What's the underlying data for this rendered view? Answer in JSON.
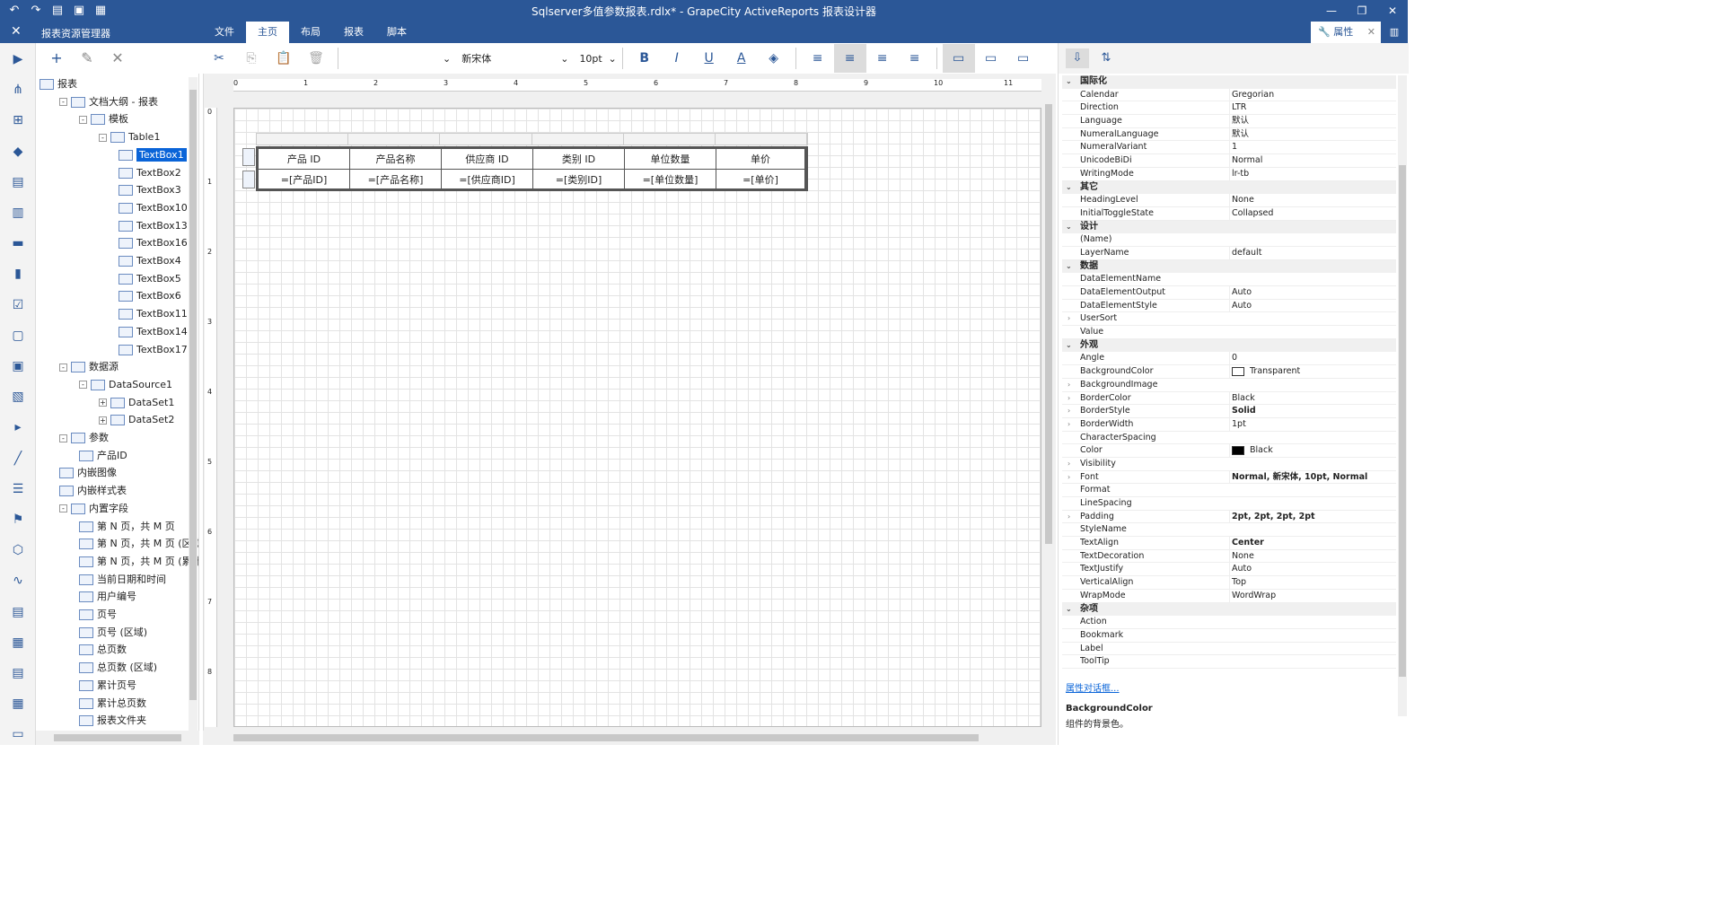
{
  "title": "Sqlserver多值参数报表.rdlx* - GrapeCity ActiveReports 报表设计器",
  "explorer_title": "报表资源管理器",
  "tabs": [
    "文件",
    "主页",
    "布局",
    "报表",
    "脚本"
  ],
  "properties_tab": "属性",
  "font": {
    "name": "新宋体",
    "size": "10pt"
  },
  "ruler": {
    "h": [
      "0",
      "1",
      "2",
      "3",
      "4",
      "5",
      "6",
      "7",
      "8",
      "9",
      "10",
      "11"
    ],
    "v": [
      "0",
      "1",
      "2",
      "3",
      "4",
      "5",
      "6",
      "7",
      "8"
    ]
  },
  "tree": [
    {
      "label": "报表",
      "level": 0,
      "tog": ""
    },
    {
      "label": "文档大纲 - 报表",
      "level": 1,
      "tog": "-"
    },
    {
      "label": "模板",
      "level": 2,
      "tog": "-"
    },
    {
      "label": "Table1",
      "level": 3,
      "tog": "-"
    },
    {
      "label": "TextBox1",
      "level": 4,
      "tog": "",
      "selected": true
    },
    {
      "label": "TextBox2",
      "level": 4,
      "tog": ""
    },
    {
      "label": "TextBox3",
      "level": 4,
      "tog": ""
    },
    {
      "label": "TextBox10",
      "level": 4,
      "tog": ""
    },
    {
      "label": "TextBox13",
      "level": 4,
      "tog": ""
    },
    {
      "label": "TextBox16",
      "level": 4,
      "tog": ""
    },
    {
      "label": "TextBox4",
      "level": 4,
      "tog": ""
    },
    {
      "label": "TextBox5",
      "level": 4,
      "tog": ""
    },
    {
      "label": "TextBox6",
      "level": 4,
      "tog": ""
    },
    {
      "label": "TextBox11",
      "level": 4,
      "tog": ""
    },
    {
      "label": "TextBox14",
      "level": 4,
      "tog": ""
    },
    {
      "label": "TextBox17",
      "level": 4,
      "tog": ""
    },
    {
      "label": "数据源",
      "level": 1,
      "tog": "-"
    },
    {
      "label": "DataSource1",
      "level": 2,
      "tog": "-"
    },
    {
      "label": "DataSet1",
      "level": 3,
      "tog": "+"
    },
    {
      "label": "DataSet2",
      "level": 3,
      "tog": "+"
    },
    {
      "label": "参数",
      "level": 1,
      "tog": "-"
    },
    {
      "label": "产品ID",
      "level": 2,
      "tog": ""
    },
    {
      "label": "内嵌图像",
      "level": 1,
      "tog": ""
    },
    {
      "label": "内嵌样式表",
      "level": 1,
      "tog": ""
    },
    {
      "label": "内置字段",
      "level": 1,
      "tog": "-"
    },
    {
      "label": "第 N 页，共 M 页",
      "level": 2,
      "tog": ""
    },
    {
      "label": "第 N 页，共 M 页 (区域",
      "level": 2,
      "tog": ""
    },
    {
      "label": "第 N 页，共 M 页 (累计",
      "level": 2,
      "tog": ""
    },
    {
      "label": "当前日期和时间",
      "level": 2,
      "tog": ""
    },
    {
      "label": "用户编号",
      "level": 2,
      "tog": ""
    },
    {
      "label": "页号",
      "level": 2,
      "tog": ""
    },
    {
      "label": "页号 (区域)",
      "level": 2,
      "tog": ""
    },
    {
      "label": "总页数",
      "level": 2,
      "tog": ""
    },
    {
      "label": "总页数 (区域)",
      "level": 2,
      "tog": ""
    },
    {
      "label": "累计页号",
      "level": 2,
      "tog": ""
    },
    {
      "label": "累计总页数",
      "level": 2,
      "tog": ""
    },
    {
      "label": "报表文件夹",
      "level": 2,
      "tog": ""
    }
  ],
  "table": {
    "headers": [
      "产品 ID",
      "产品名称",
      "供应商 ID",
      "类别 ID",
      "单位数量",
      "单价"
    ],
    "details": [
      "=[产品ID]",
      "=[产品名称]",
      "=[供应商ID]",
      "=[类别ID]",
      "=[单位数量]",
      "=[单价]"
    ]
  },
  "props": [
    {
      "cat": "国际化"
    },
    {
      "k": "Calendar",
      "v": "Gregorian"
    },
    {
      "k": "Direction",
      "v": "LTR"
    },
    {
      "k": "Language",
      "v": "默认"
    },
    {
      "k": "NumeralLanguage",
      "v": "默认"
    },
    {
      "k": "NumeralVariant",
      "v": "1"
    },
    {
      "k": "UnicodeBiDi",
      "v": "Normal"
    },
    {
      "k": "WritingMode",
      "v": "lr-tb"
    },
    {
      "cat": "其它"
    },
    {
      "k": "HeadingLevel",
      "v": "None"
    },
    {
      "k": "InitialToggleState",
      "v": "Collapsed"
    },
    {
      "cat": "设计"
    },
    {
      "k": "(Name)",
      "v": ""
    },
    {
      "k": "LayerName",
      "v": "default"
    },
    {
      "cat": "数据"
    },
    {
      "k": "DataElementName",
      "v": ""
    },
    {
      "k": "DataElementOutput",
      "v": "Auto"
    },
    {
      "k": "DataElementStyle",
      "v": "Auto"
    },
    {
      "k": "UserSort",
      "v": "",
      "ex": true
    },
    {
      "k": "Value",
      "v": ""
    },
    {
      "cat": "外观"
    },
    {
      "k": "Angle",
      "v": "0"
    },
    {
      "k": "BackgroundColor",
      "v": "Transparent",
      "swatch": "#ffffff"
    },
    {
      "k": "BackgroundImage",
      "v": "",
      "ex": true
    },
    {
      "k": "BorderColor",
      "v": "Black",
      "ex": true
    },
    {
      "k": "BorderStyle",
      "v": "Solid",
      "ex": true,
      "bold": true
    },
    {
      "k": "BorderWidth",
      "v": "1pt",
      "ex": true
    },
    {
      "k": "CharacterSpacing",
      "v": ""
    },
    {
      "k": "Color",
      "v": "Black",
      "swatch": "#000000"
    },
    {
      "k": "Visibility",
      "v": "",
      "ex": true
    },
    {
      "k": "Font",
      "v": "Normal, 新宋体, 10pt, Normal",
      "ex": true,
      "bold": true
    },
    {
      "k": "Format",
      "v": ""
    },
    {
      "k": "LineSpacing",
      "v": ""
    },
    {
      "k": "Padding",
      "v": "2pt, 2pt, 2pt, 2pt",
      "ex": true,
      "bold": true
    },
    {
      "k": "StyleName",
      "v": ""
    },
    {
      "k": "TextAlign",
      "v": "Center",
      "bold": true
    },
    {
      "k": "TextDecoration",
      "v": "None"
    },
    {
      "k": "TextJustify",
      "v": "Auto"
    },
    {
      "k": "VerticalAlign",
      "v": "Top"
    },
    {
      "k": "WrapMode",
      "v": "WordWrap"
    },
    {
      "cat": "杂项"
    },
    {
      "k": "Action",
      "v": ""
    },
    {
      "k": "Bookmark",
      "v": ""
    },
    {
      "k": "Label",
      "v": ""
    },
    {
      "k": "ToolTip",
      "v": ""
    }
  ],
  "prop_link": "属性对话框...",
  "prop_desc_name": "BackgroundColor",
  "prop_desc": "组件的背景色。",
  "icons": {
    "undo": "undo-icon",
    "redo": "redo-icon",
    "new": "new-file-icon",
    "open": "open-folder-icon",
    "save": "save-icon"
  }
}
